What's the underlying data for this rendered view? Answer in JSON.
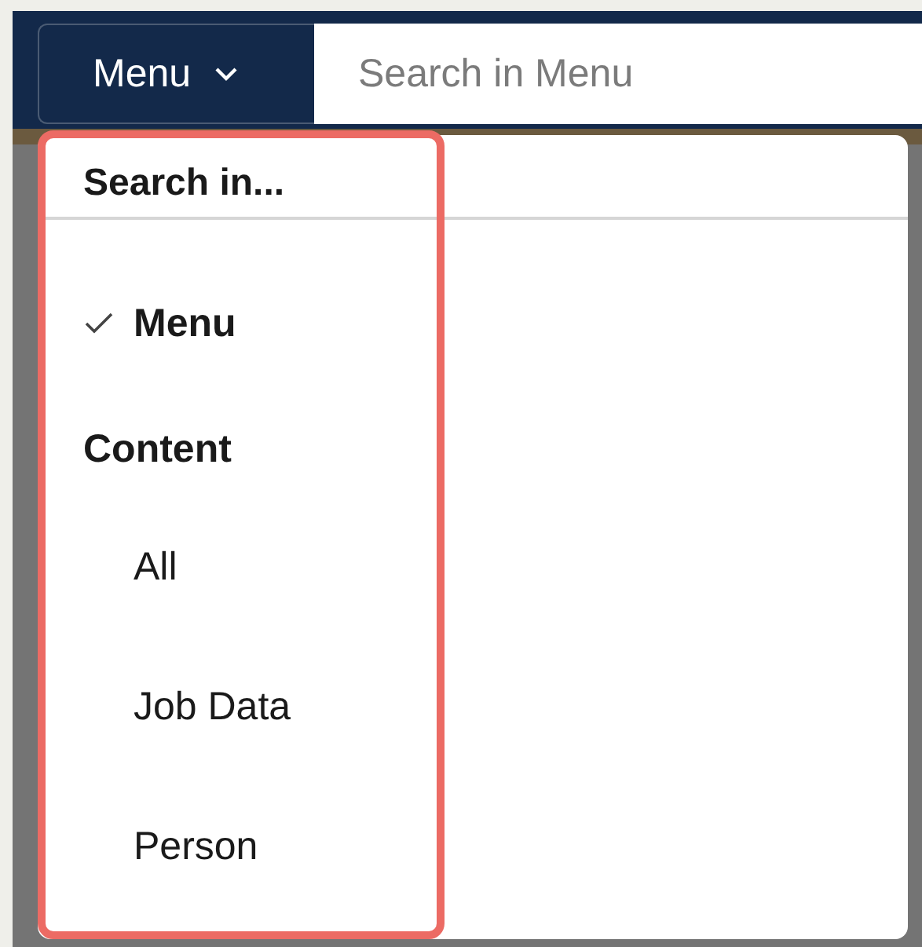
{
  "search_bar": {
    "scope_button": {
      "label": "Menu"
    },
    "search_field": {
      "placeholder": "Search in Menu"
    }
  },
  "dropdown": {
    "header": "Search in...",
    "items": [
      {
        "kind": "option",
        "label": "Menu",
        "selected": true
      },
      {
        "kind": "heading",
        "label": "Content"
      },
      {
        "kind": "option",
        "label": "All",
        "selected": false
      },
      {
        "kind": "option",
        "label": "Job Data",
        "selected": false
      },
      {
        "kind": "option",
        "label": "Person",
        "selected": false
      }
    ]
  }
}
